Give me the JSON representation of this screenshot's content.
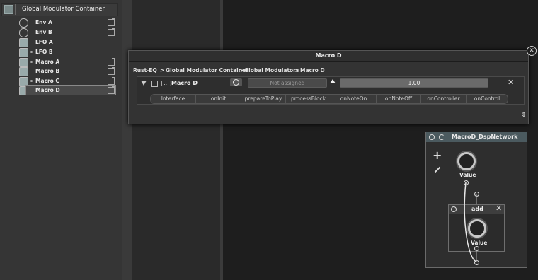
{
  "tree": {
    "title": "Global Modulator Container",
    "items": [
      {
        "label": "Env A",
        "icon": "envelope-icon",
        "ext": true
      },
      {
        "label": "Env B",
        "icon": "envelope-icon",
        "ext": true
      },
      {
        "label": "LFO A",
        "icon": "lfo-icon",
        "ext": false
      },
      {
        "label": "LFO B",
        "icon": "lfo-icon",
        "ext": false
      },
      {
        "label": "Macro A",
        "icon": "macro-icon",
        "ext": true
      },
      {
        "label": "Macro B",
        "icon": "macro-icon",
        "ext": true
      },
      {
        "label": "Macro C",
        "icon": "macro-icon",
        "ext": true
      },
      {
        "label": "Macro D",
        "icon": "macro-icon",
        "ext": true
      }
    ]
  },
  "popup": {
    "title": "Macro D",
    "breadcrumb": [
      "Rust-EQ",
      "Global Modulator Container",
      "Global Modulators",
      "Macro D"
    ],
    "sep": ">",
    "module": {
      "name": "Macro D",
      "braces": "{...}",
      "assign_text": "Not assigned",
      "value_text": "1.00",
      "value": 1.0,
      "tabs": [
        "Interface",
        "onInit",
        "prepareToPlay",
        "processBlock",
        "onNoteOn",
        "onNoteOff",
        "onController",
        "onControl"
      ]
    },
    "resize_glyph": "⇕",
    "close_glyph": "✕"
  },
  "dsp": {
    "title": "MacroD_DspNetwork",
    "plus": "+",
    "knob_label": "Value",
    "node": {
      "title": "add",
      "knob_label": "Value"
    }
  },
  "colors": {
    "accent": "#4b5a5f",
    "background": "#1e1e1e"
  }
}
